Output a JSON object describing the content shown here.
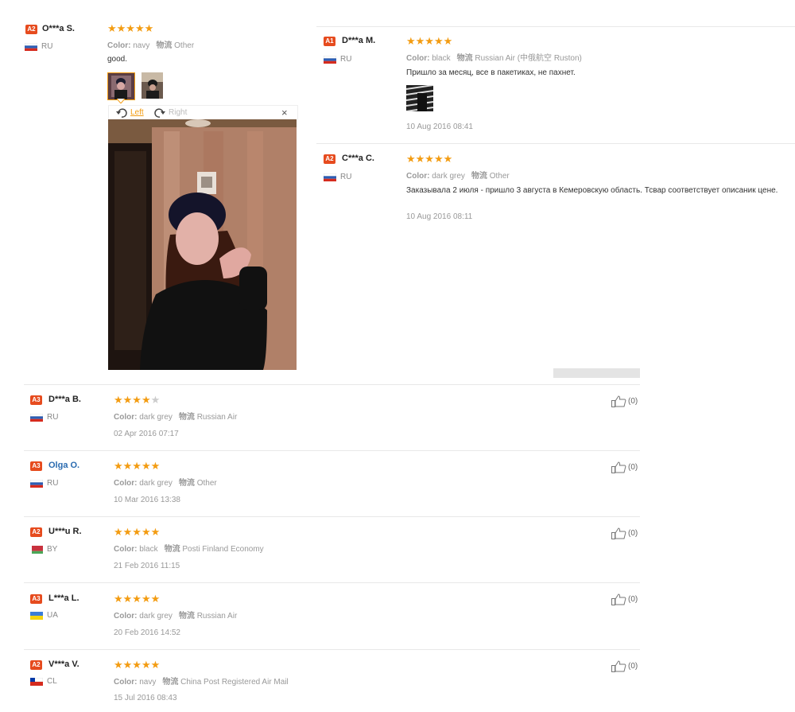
{
  "colors": {
    "star": "#f39c12",
    "badge": "#e64b1e",
    "link": "#2a6bb0"
  },
  "labels": {
    "color": "Color:",
    "logistics": "物流"
  },
  "viewer": {
    "left": "Left",
    "right": "Right",
    "close": "×"
  },
  "reviews": [
    {
      "badge": "A2",
      "user": "O***a S.",
      "country": "RU",
      "rating": 5,
      "color": "navy",
      "shipping": "Other",
      "text": "good."
    },
    {
      "badge": "A1",
      "user": "D***a M.",
      "country": "RU",
      "rating": 5,
      "color": "black",
      "shipping": "Russian Air (中俄航空 Ruston)",
      "text": "Пришло за месяц, все в пакетиках, не пахнет.",
      "date": "10 Aug 2016 08:41"
    },
    {
      "badge": "A2",
      "user": "C***a C.",
      "country": "RU",
      "rating": 5,
      "color": "dark grey",
      "shipping": "Other",
      "text": "Заказывала 2 июля - пришло 3 августа в Кемеровскую область. Тсвар соответствует описаник цене.",
      "date": "10 Aug 2016 08:11"
    },
    {
      "badge": "A3",
      "user": "D***a B.",
      "country": "RU",
      "rating": 4,
      "color": "dark grey",
      "shipping": "Russian Air",
      "date": "02 Apr 2016 07:17",
      "helpful": "(0)"
    },
    {
      "badge": "A3",
      "user": "Olga O.",
      "country": "RU",
      "rating": 5,
      "color": "dark grey",
      "shipping": "Other",
      "date": "10 Mar 2016 13:38",
      "helpful": "(0)"
    },
    {
      "badge": "A2",
      "user": "U***u R.",
      "country": "BY",
      "rating": 5,
      "color": "black",
      "shipping": "Posti Finland Economy",
      "date": "21 Feb 2016 11:15",
      "helpful": "(0)"
    },
    {
      "badge": "A3",
      "user": "L***a L.",
      "country": "UA",
      "rating": 5,
      "color": "dark grey",
      "shipping": "Russian Air",
      "date": "20 Feb 2016 14:52",
      "helpful": "(0)"
    },
    {
      "badge": "A2",
      "user": "V***a V.",
      "country": "CL",
      "rating": 5,
      "color": "navy",
      "shipping": "China Post Registered Air Mail",
      "date": "15 Jul 2016 08:43",
      "helpful": "(0)"
    }
  ]
}
